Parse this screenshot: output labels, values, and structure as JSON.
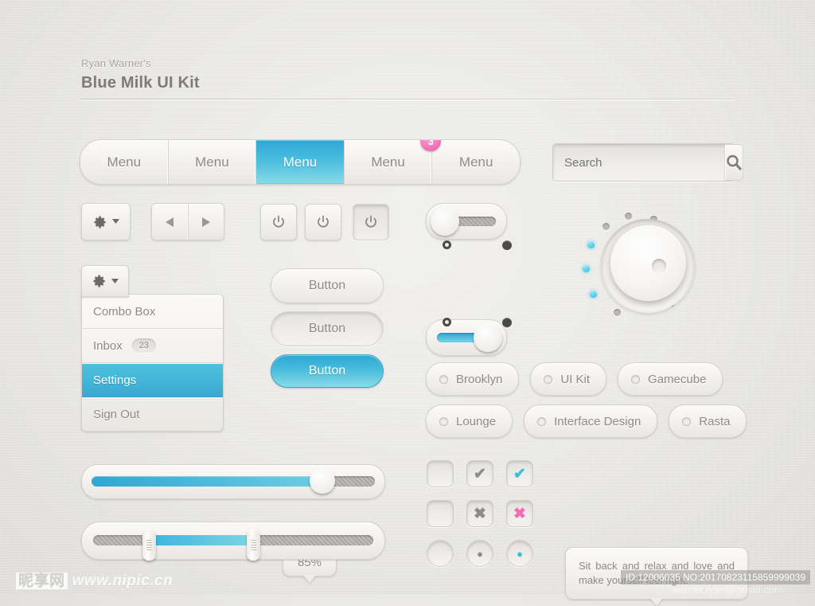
{
  "header": {
    "subtitle": "Ryan Warner's",
    "title": "Blue Milk UI Kit"
  },
  "colors": {
    "accent_blue": "#2ea7d4",
    "accent_blue_light": "#8adbe6",
    "badge_pink": "#f06cb4",
    "surface": "#f3f1ee",
    "text": "#8e8b86"
  },
  "menubar": {
    "items": [
      {
        "label": "Menu",
        "active": false
      },
      {
        "label": "Menu",
        "active": false
      },
      {
        "label": "Menu",
        "active": true
      },
      {
        "label": "Menu",
        "active": false,
        "badge": "3"
      },
      {
        "label": "Menu",
        "active": false
      }
    ]
  },
  "search": {
    "value": "",
    "placeholder": "Search",
    "icon": "search-icon"
  },
  "toolbar": {
    "gear": {
      "icon": "gear-icon",
      "caret": "chevron-down-icon"
    },
    "nav": {
      "prev_icon": "triangle-left-icon",
      "next_icon": "triangle-right-icon"
    },
    "power_buttons": [
      {
        "icon": "power-icon",
        "state": "normal"
      },
      {
        "icon": "power-icon",
        "state": "normal"
      },
      {
        "icon": "power-icon",
        "state": "pressed"
      }
    ]
  },
  "combobox": {
    "tab_icon": "gear-icon",
    "tab_caret": "chevron-down-icon",
    "items": [
      {
        "label": "Combo Box",
        "selected": false
      },
      {
        "label": "Inbox",
        "badge": "23",
        "selected": false
      },
      {
        "label": "Settings",
        "selected": true
      },
      {
        "label": "Sign Out",
        "selected": false
      }
    ]
  },
  "buttons": [
    {
      "label": "Button",
      "state": "normal"
    },
    {
      "label": "Button",
      "state": "pressed"
    },
    {
      "label": "Button",
      "state": "active"
    }
  ],
  "toggles": [
    {
      "state": "off",
      "leds": [
        "hollow",
        "solid"
      ]
    },
    {
      "state": "on",
      "leds": [
        "hollow",
        "solid"
      ]
    }
  ],
  "knob": {
    "name": "volume-knob",
    "dots": [
      {
        "on": true
      },
      {
        "on": true
      },
      {
        "on": true
      },
      {
        "on": false
      },
      {
        "on": false
      },
      {
        "on": false
      },
      {
        "on": false
      },
      {
        "on": false
      },
      {
        "on": false
      },
      {
        "on": false
      },
      {
        "on": false
      }
    ]
  },
  "tags": {
    "row1": [
      {
        "label": "Brooklyn"
      },
      {
        "label": "UI Kit"
      },
      {
        "label": "Gamecube"
      }
    ],
    "row2": [
      {
        "label": "Lounge"
      },
      {
        "label": "Interface Design"
      },
      {
        "label": "Rasta"
      }
    ]
  },
  "checkbox_grid": [
    {
      "shape": "square",
      "glyph": "",
      "color": ""
    },
    {
      "shape": "square",
      "glyph": "✔",
      "color": "#8e8b86"
    },
    {
      "shape": "square",
      "glyph": "✔",
      "color": "#3cbede"
    },
    {
      "shape": "square",
      "glyph": "",
      "color": ""
    },
    {
      "shape": "square",
      "glyph": "✖",
      "color": "#8e8b86"
    },
    {
      "shape": "square",
      "glyph": "✖",
      "color": "#f06cb4"
    },
    {
      "shape": "round",
      "glyph": "",
      "color": ""
    },
    {
      "shape": "round",
      "glyph": "●",
      "color": "#8e8b86"
    },
    {
      "shape": "round",
      "glyph": "●",
      "color": "#3cbede"
    }
  ],
  "tooltip": {
    "text": "Sit back and relax and love and make yourself feel right."
  },
  "slider": {
    "value_label": "85%",
    "fill_percent": 85
  },
  "range_slider": {
    "start_percent": 20,
    "end_percent": 57
  },
  "watermark": {
    "site_cn": "昵享网",
    "site_url": "www.nipic.cn",
    "id_text": "ID:12006035 NO:20170823115859999039",
    "email": "warner.ryan@gmail.com"
  }
}
